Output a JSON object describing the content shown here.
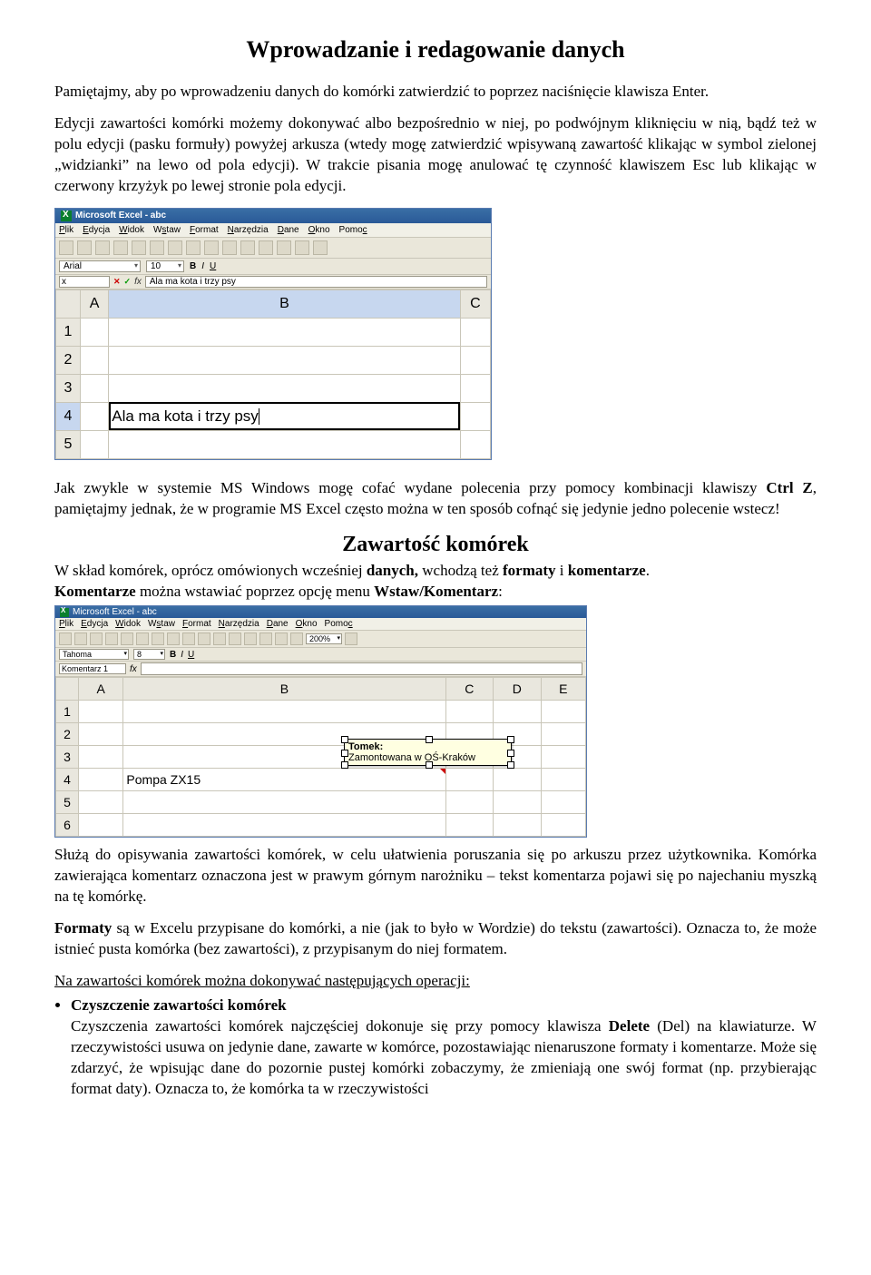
{
  "title": "Wprowadzanie i redagowanie danych",
  "p1": "Pamiętajmy, aby po wprowadzeniu danych do komórki zatwierdzić to poprzez naciśnięcie klawisza Enter.",
  "p2": "Edycji zawartości komórki możemy dokonywać albo bezpośrednio w niej, po podwójnym kliknięciu w nią, bądź też w polu edycji (pasku formuły) powyżej arkusza (wtedy mogę zatwierdzić wpisywaną zawartość klikając w symbol zielonej „widzianki” na lewo od pola edycji). W trakcie pisania mogę anulować tę czynność klawiszem Esc lub klikając w czerwony krzyżyk po lewej stronie pola edycji.",
  "shot1": {
    "windowTitle": "Microsoft Excel - abc",
    "menus": [
      "Plik",
      "Edycja",
      "Widok",
      "Wstaw",
      "Format",
      "Narzędzia",
      "Dane",
      "Okno",
      "Pomoc"
    ],
    "fontName": "Arial",
    "fontSize": "10",
    "boldLabel": "B",
    "italicLabel": "I",
    "underlineLabel": "U",
    "nameBox": "x",
    "fx": "fx",
    "formula": "Ala ma kota i trzy psy",
    "cancelMark": "✕",
    "okMark": "✓",
    "colHeaders": [
      "A",
      "B",
      "C"
    ],
    "rowHeaders": [
      "1",
      "2",
      "3",
      "4",
      "5"
    ],
    "cellText": "Ala ma kota i trzy psy"
  },
  "p3a": "Jak zwykle w systemie MS Windows mogę cofać wydane polecenia przy pomocy kombinacji klawiszy ",
  "p3b": "Ctrl Z",
  "p3c": ", pamiętajmy jednak, że w programie MS Excel często można w ten sposób cofnąć się jedynie jedno polecenie wstecz!",
  "subtitle": "Zawartość komórek",
  "p4a": "W skład komórek, oprócz omówionych wcześniej ",
  "p4b": "danych,",
  "p4c": " wchodzą też ",
  "p4d": "formaty",
  "p4e": " i ",
  "p4f": "komentarze",
  "p4g": ".",
  "p5a": "Komentarze",
  "p5b": " można wstawiać poprzez opcję menu ",
  "p5c": "Wstaw/Komentarz",
  "p5d": ":",
  "shot2": {
    "windowTitle": "Microsoft Excel - abc",
    "menus": [
      "Plik",
      "Edycja",
      "Widok",
      "Wstaw",
      "Format",
      "Narzędzia",
      "Dane",
      "Okno",
      "Pomoc"
    ],
    "zoom": "200%",
    "fontName": "Tahoma",
    "fontSize": "8",
    "boldLabel": "B",
    "italicLabel": "I",
    "underlineLabel": "U",
    "nameBox": "Komentarz 1",
    "fx": "fx",
    "colHeaders": [
      "A",
      "B",
      "C",
      "D",
      "E"
    ],
    "rowHeaders": [
      "1",
      "2",
      "3",
      "4",
      "5",
      "6"
    ],
    "cellText": "Pompa ZX15",
    "commentAuthor": "Tomek:",
    "commentBody": "Zamontowana w OŚ-Kraków"
  },
  "p6": "Służą do opisywania zawartości komórek, w celu ułatwienia poruszania się po arkuszu przez użytkownika. Komórka zawierająca komentarz oznaczona jest w prawym górnym narożniku – tekst komentarza pojawi się po najechaniu myszką na tę komórkę.",
  "p7a": "Formaty",
  "p7b": " są w Excelu przypisane do komórki, a nie (jak to było w Wordzie) do tekstu (zawartości). Oznacza to, że może istnieć pusta komórka (bez zawartości), z przypisanym do niej formatem.",
  "p8": "Na zawartości komórek można dokonywać następujących operacji:",
  "li1a": "Czyszczenie zawartości komórek",
  "li1b": "Czyszczenia zawartości komórek najczęściej dokonuje się przy pomocy klawisza ",
  "li1c": "Delete",
  "li1d": " (Del) na klawiaturze. W rzeczywistości usuwa on jedynie dane, zawarte w komórce, pozostawiając nienaruszone formaty i komentarze. Może się zdarzyć, że wpisując dane do pozornie pustej komórki zobaczymy, że zmieniają one swój format (np. przybierając format daty). Oznacza to, że komórka ta w rzeczywistości"
}
